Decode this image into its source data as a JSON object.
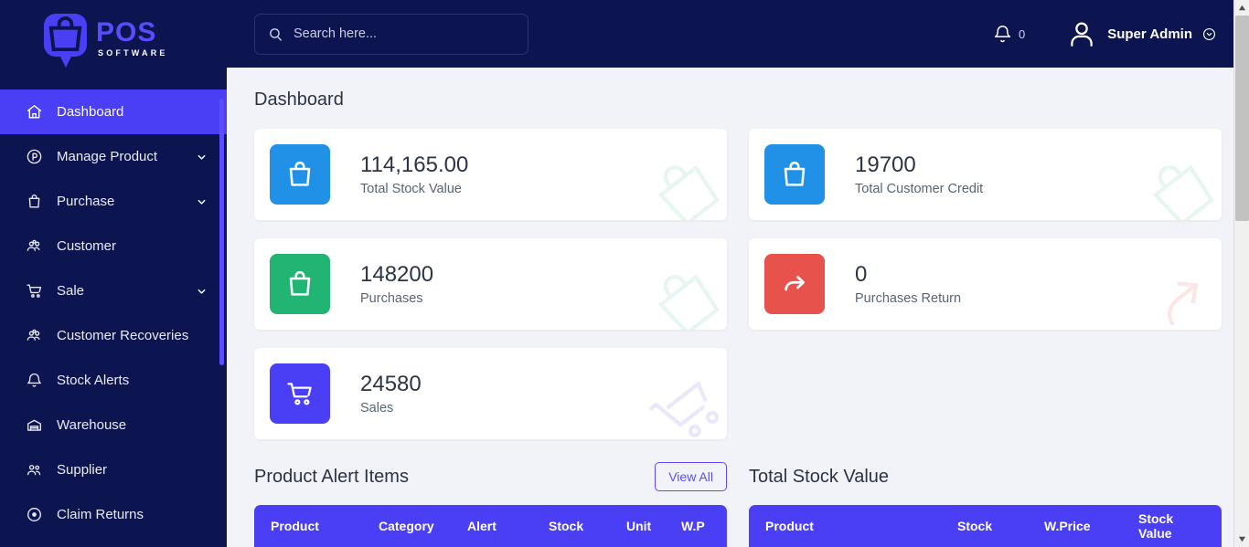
{
  "brand": {
    "name": "POS",
    "tagline": "SOFTWARE",
    "logo_icon": "shopping-bag-pin-icon",
    "accent": "#4b3ff5",
    "sidebar_bg": "#0d1551"
  },
  "sidebar": {
    "items": [
      {
        "label": "Dashboard",
        "icon": "home-icon",
        "active": true,
        "has_chevron": false
      },
      {
        "label": "Manage Product",
        "icon": "product-circle-icon",
        "active": false,
        "has_chevron": true
      },
      {
        "label": "Purchase",
        "icon": "purchase-bag-icon",
        "active": false,
        "has_chevron": true
      },
      {
        "label": "Customer",
        "icon": "customers-icon",
        "active": false,
        "has_chevron": false
      },
      {
        "label": "Sale",
        "icon": "cart-icon",
        "active": false,
        "has_chevron": true
      },
      {
        "label": "Customer Recoveries",
        "icon": "customers-icon",
        "active": false,
        "has_chevron": false
      },
      {
        "label": "Stock Alerts",
        "icon": "bell-icon",
        "active": false,
        "has_chevron": false
      },
      {
        "label": "Warehouse",
        "icon": "warehouse-icon",
        "active": false,
        "has_chevron": false
      },
      {
        "label": "Supplier",
        "icon": "supplier-people-icon",
        "active": false,
        "has_chevron": false
      },
      {
        "label": "Claim Returns",
        "icon": "target-dot-icon",
        "active": false,
        "has_chevron": false
      }
    ]
  },
  "topbar": {
    "search": {
      "placeholder": "Search here...",
      "value": "",
      "icon": "search-icon"
    },
    "notifications": {
      "icon": "bell-icon",
      "count": "0"
    },
    "user": {
      "name": "Super Admin",
      "avatar_icon": "user-avatar-icon",
      "chevron_icon": "chevron-down-circle-icon"
    }
  },
  "page": {
    "title": "Dashboard"
  },
  "stat_cards": [
    {
      "value": "114,165.00",
      "label": "Total Stock Value",
      "icon": "shopping-bag-icon",
      "color": "#2091e6",
      "watermark": "bag-watermark",
      "watermark_color": "#d8f0e2"
    },
    {
      "value": "19700",
      "label": "Total Customer Credit",
      "icon": "shopping-bag-icon",
      "color": "#2091e6",
      "watermark": "bag-watermark",
      "watermark_color": "#d8f0e2"
    },
    {
      "value": "148200",
      "label": "Purchases",
      "icon": "shopping-bag-icon",
      "color": "#22b473",
      "watermark": "bag-watermark",
      "watermark_color": "#d8f0e2"
    },
    {
      "value": "0",
      "label": "Purchases Return",
      "icon": "return-arrow-icon",
      "color": "#e8524c",
      "watermark": "arrow-watermark",
      "watermark_color": "#f7d4d2"
    },
    {
      "value": "24580",
      "label": "Sales",
      "icon": "cart-icon",
      "color": "#4b3ff5",
      "watermark": "cart-watermark",
      "watermark_color": "#dcdbf7"
    }
  ],
  "product_alert_panel": {
    "title": "Product Alert Items",
    "view_all_label": "View All",
    "columns": [
      "Product",
      "Category",
      "Alert",
      "Stock",
      "Unit",
      "W.P"
    ]
  },
  "total_stock_panel": {
    "title": "Total Stock Value",
    "columns": [
      "Product",
      "Stock",
      "W.Price",
      "Stock Value"
    ]
  },
  "scrollbars": {
    "sidebar_thumb": true,
    "page_up_arrow": "scroll-up-arrow-icon",
    "page_down_arrow": "scroll-down-arrow-icon"
  }
}
